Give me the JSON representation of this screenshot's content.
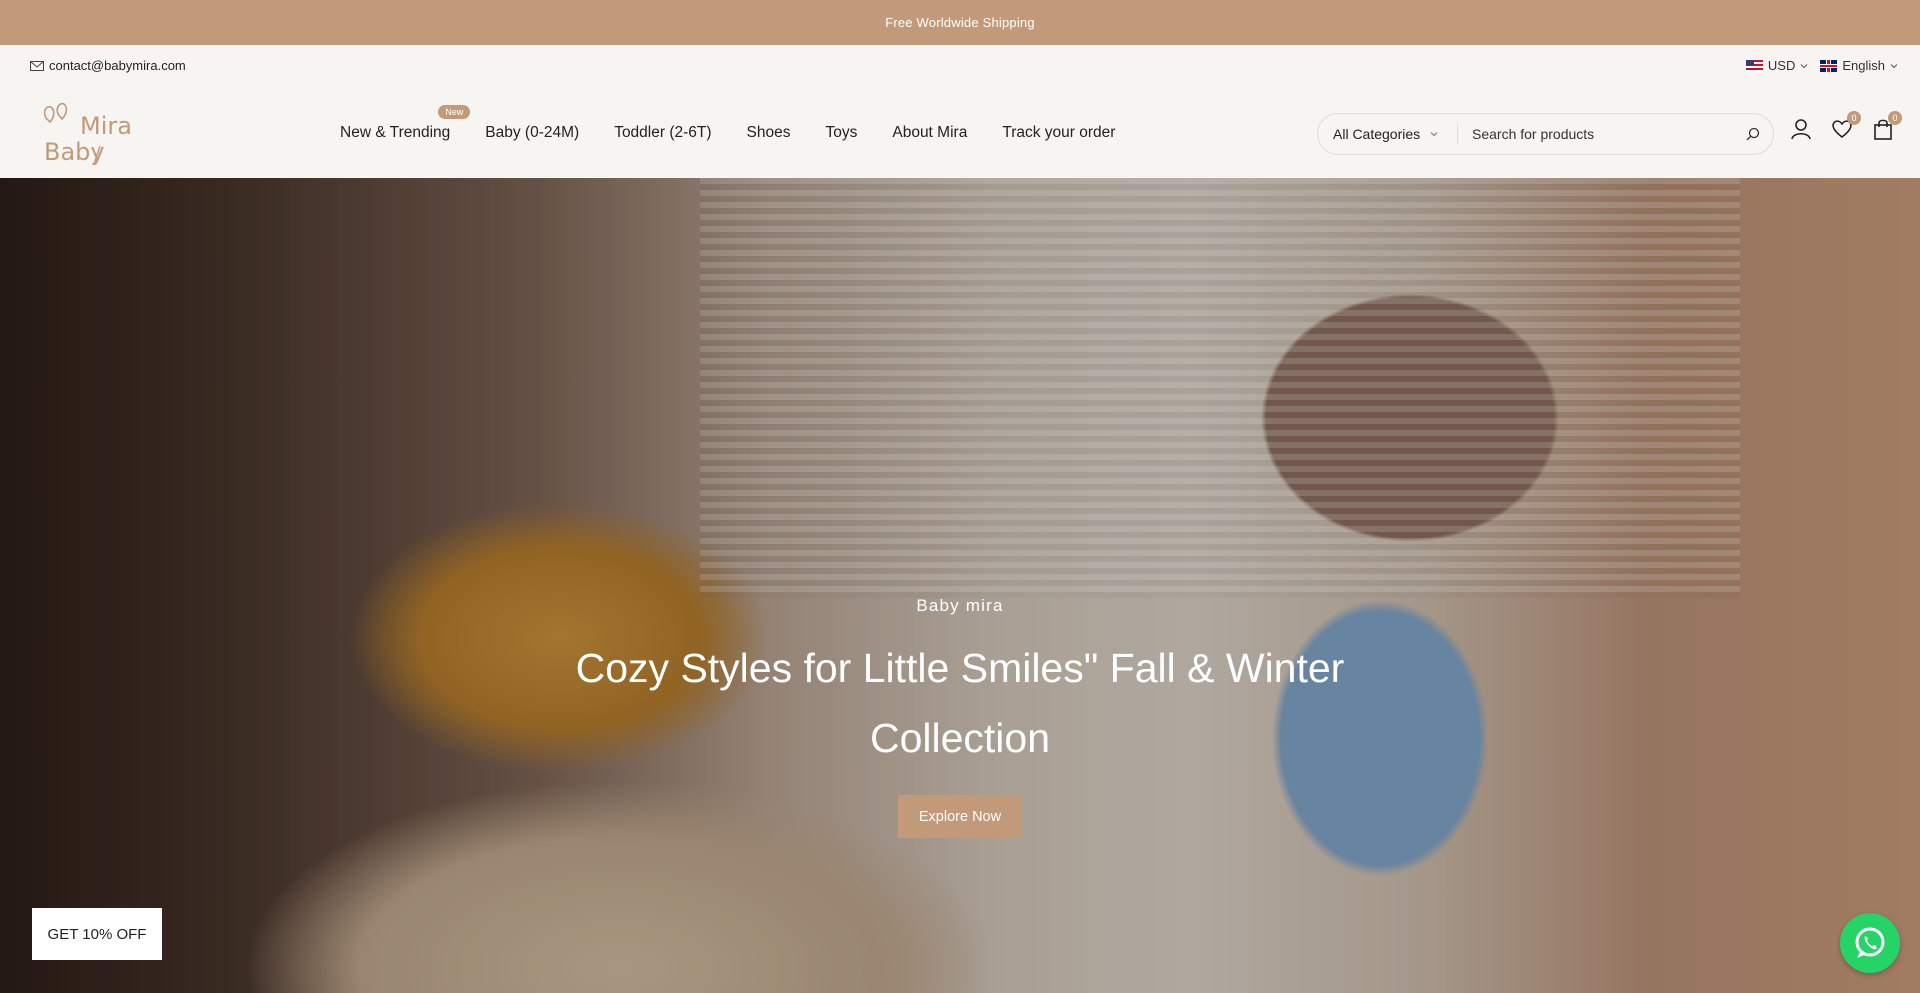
{
  "announcement": "Free Worldwide Shipping",
  "topbar": {
    "email": "contact@babymira.com",
    "currency": "USD",
    "language": "English"
  },
  "logo": {
    "line1": "Mira",
    "line2": "Baby"
  },
  "nav": {
    "items": [
      {
        "label": "New & Trending",
        "badge": "New"
      },
      {
        "label": "Baby (0-24M)"
      },
      {
        "label": "Toddler (2-6T)"
      },
      {
        "label": "Shoes"
      },
      {
        "label": "Toys"
      },
      {
        "label": "About Mira"
      },
      {
        "label": "Track your order"
      }
    ]
  },
  "search": {
    "category": "All Categories",
    "placeholder": "Search for products"
  },
  "header_icons": {
    "wishlist_count": "0",
    "cart_count": "0"
  },
  "hero": {
    "eyebrow": "Baby mira",
    "title": "Cozy Styles for Little Smiles\" Fall & Winter Collection",
    "cta": "Explore Now"
  },
  "promo": {
    "label": "GET 10% OFF"
  },
  "colors": {
    "accent": "#c39a79",
    "whatsapp": "#25d366",
    "background": "#f7f5f2"
  }
}
